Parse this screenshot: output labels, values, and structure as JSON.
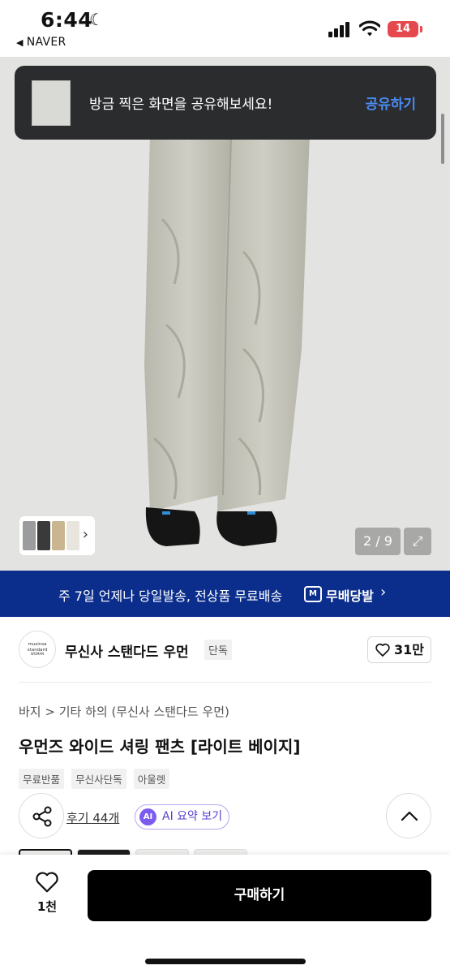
{
  "status_bar": {
    "time": "6:44",
    "back_app": "NAVER",
    "battery": "14"
  },
  "share_toast": {
    "message": "방금 찍은 화면을 공유해보세요!",
    "action": "공유하기"
  },
  "gallery": {
    "counter": "2 / 9"
  },
  "banner": {
    "text": "주 7일 언제나 당일발송, 전상품 무료배송",
    "logo": "M",
    "brand": "무배당발"
  },
  "brand": {
    "logo_line1": "musinsa",
    "logo_line2": "standard",
    "logo_line3": "WOMAN",
    "name": "무신사 스탠다드 우먼",
    "tag": "단독",
    "likes": "31만"
  },
  "product": {
    "breadcrumb": "바지 > 기타 하의 (무신사 스탠다드 우먼)",
    "title": "우먼즈 와이드 셔링 팬츠 [라이트 베이지]",
    "tags": [
      "무료반품",
      "무신사단독",
      "아울렛"
    ],
    "reviews": "후기 44개",
    "ai_badge": "AI",
    "ai_label": "AI 요약 보기"
  },
  "bottom_bar": {
    "wish_count": "1천",
    "buy_label": "구매하기"
  },
  "colors": {
    "banner_bg": "#0b2e8c",
    "toast_bg": "#2b2c2e",
    "toast_action": "#4b8bf5",
    "ai_accent": "#7c5cf0",
    "battery": "#e5484d"
  }
}
